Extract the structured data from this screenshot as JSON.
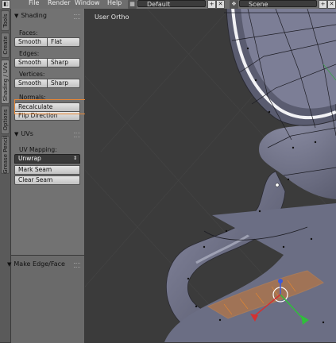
{
  "topbar": {
    "menus": [
      "File",
      "Render",
      "Window",
      "Help"
    ],
    "layout_value": "Default",
    "scene_value": "Scene"
  },
  "tabs": [
    "Tools",
    "Create",
    "Shading / UVs",
    "Options",
    "Grease Pencil"
  ],
  "shading": {
    "title": "Shading",
    "faces_label": "Faces:",
    "faces_smooth": "Smooth",
    "faces_flat": "Flat",
    "edges_label": "Edges:",
    "edges_smooth": "Smooth",
    "edges_sharp": "Sharp",
    "vertices_label": "Vertices:",
    "vertices_smooth": "Smooth",
    "vertices_sharp": "Sharp",
    "normals_label": "Normals:",
    "recalculate": "Recalculate",
    "flip_direction": "Flip Direction"
  },
  "uvs": {
    "title": "UVs",
    "mapping_label": "UV Mapping:",
    "unwrap": "Unwrap",
    "mark_seam": "Mark Seam",
    "clear_seam": "Clear Seam"
  },
  "operator_panel": {
    "title": "Make Edge/Face"
  },
  "viewport": {
    "label": "User Ortho"
  },
  "colors": {
    "highlight": "#e88735",
    "mesh_fill": "#6b6e84",
    "selected_face": "#e07a1f",
    "background": "#393939"
  }
}
